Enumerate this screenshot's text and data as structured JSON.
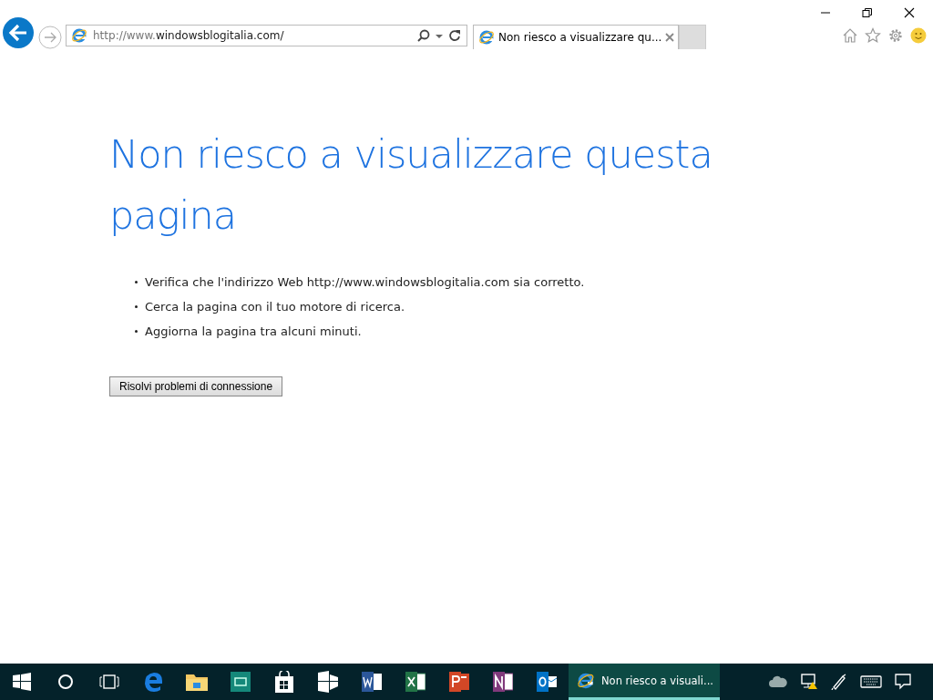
{
  "address_bar": {
    "url_prefix": "http://www.",
    "url_host": "windowsblogitalia.com/"
  },
  "tabs": [
    {
      "title": "Non riesco a visualizzare qu...",
      "selected": true
    }
  ],
  "page": {
    "heading": "Non riesco a visualizzare questa pagina",
    "bullets": [
      "Verifica che l'indirizzo Web http://www.windowsblogitalia.com sia corretto.",
      "Cerca la pagina con il tuo motore di ricerca.",
      "Aggiorna la pagina tra alcuni minuti."
    ],
    "button": "Risolvi problemi di connessione"
  },
  "taskbar": {
    "items": [
      {
        "kind": "start"
      },
      {
        "kind": "search"
      },
      {
        "kind": "taskview"
      },
      {
        "kind": "edge"
      },
      {
        "kind": "explorer"
      },
      {
        "kind": "app"
      },
      {
        "kind": "store"
      },
      {
        "kind": "tile"
      },
      {
        "kind": "word"
      },
      {
        "kind": "excel"
      },
      {
        "kind": "powerpoint"
      },
      {
        "kind": "onenote"
      },
      {
        "kind": "outlook"
      },
      {
        "kind": "window",
        "label": "Non riesco a visuali...",
        "selected": true
      }
    ],
    "tray": [
      {
        "kind": "cloud"
      },
      {
        "kind": "network"
      },
      {
        "kind": "pen"
      },
      {
        "kind": "keyboard"
      },
      {
        "kind": "notifications"
      }
    ]
  }
}
